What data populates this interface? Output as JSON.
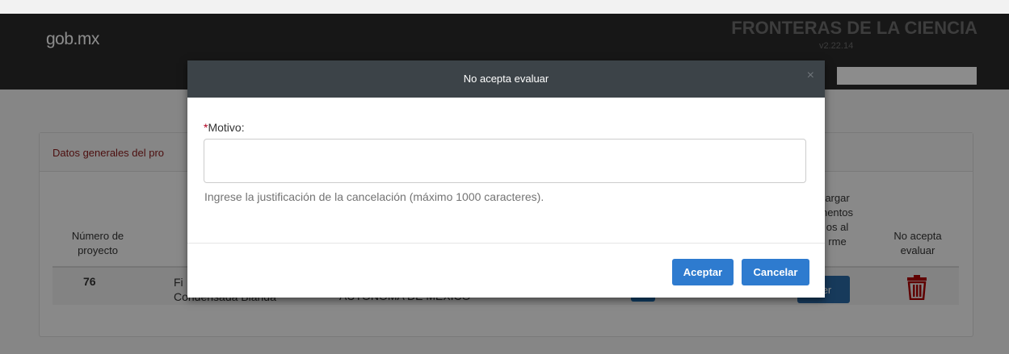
{
  "header": {
    "logo": "gob.mx",
    "app_title": "FRONTERAS DE LA CIENCIA",
    "version": "v2.22.14"
  },
  "panel": {
    "title": "Datos generales del pro",
    "columns": {
      "project_number_line1": "Número de",
      "project_number_line2": "proyecto",
      "download_line1": "argar",
      "download_line2": "nentos",
      "download_line3": "os al",
      "download_line4": "rme",
      "no_accept_line1": "No acepta",
      "no_accept_line2": "evaluar"
    },
    "row": {
      "number": "76",
      "title_line1": "Fi",
      "title_line2": "Condensada Blanda",
      "institution": "AUTÓNOMA DE MÉXICO",
      "view_button": "Ver",
      "delete_icon": "trash-icon"
    }
  },
  "modal": {
    "title": "No acepta evaluar",
    "close_symbol": "×",
    "required_mark": "*",
    "motivo_label": "Motivo:",
    "motivo_value": "",
    "help_text": "Ingrese la justificación de la cancelación (máximo 1000 caracteres).",
    "accept_button": "Aceptar",
    "cancel_button": "Cancelar"
  },
  "colors": {
    "header_bg": "#2a2a2a",
    "modal_header_bg": "#3c4348",
    "primary_button": "#2e7bcf",
    "panel_title": "#8b1a1a",
    "trash_icon": "#b00000"
  }
}
